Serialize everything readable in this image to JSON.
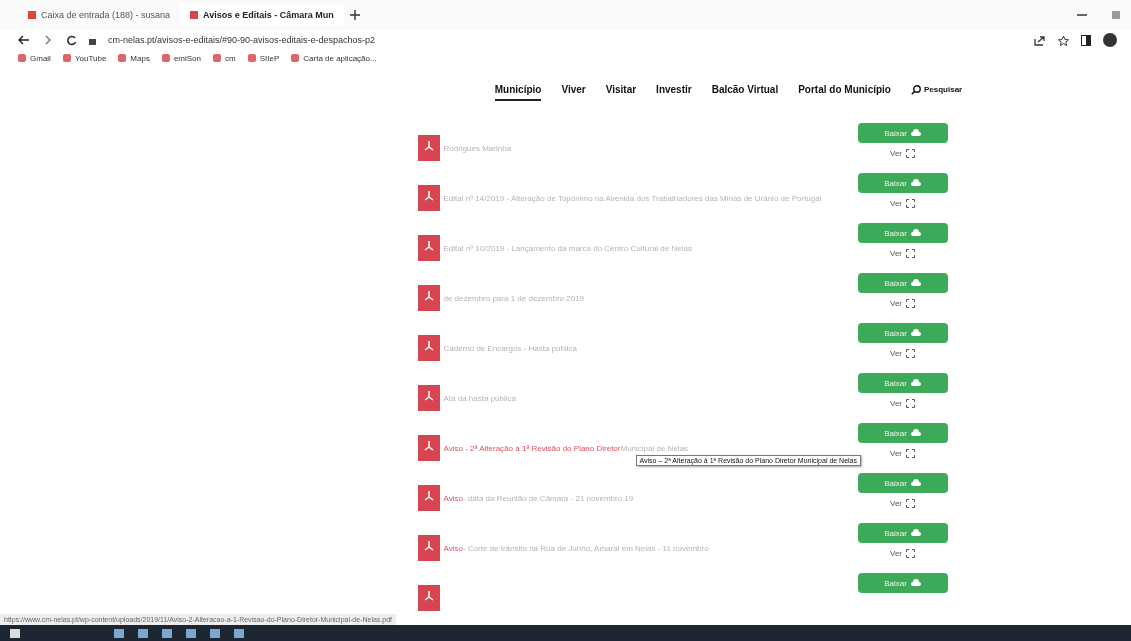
{
  "browser": {
    "tabs": [
      {
        "title": "Caixa de entrada (188) - susana",
        "selected": false
      },
      {
        "title": "Avisos e Editais - Câmara Mun",
        "selected": true
      }
    ],
    "address": "cm-nelas.pt/avisos-e-editais/#90-90-avisos-editais-e-despachos-p2",
    "bookmarks": [
      "Gmail",
      "YouTube",
      "Maps",
      "emiSon",
      "cm",
      "SIIeP",
      "Carta de aplicação..."
    ]
  },
  "nav": [
    {
      "label": "Município",
      "selected": true
    },
    {
      "label": "Viver",
      "selected": false
    },
    {
      "label": "Visitar",
      "selected": false
    },
    {
      "label": "Investir",
      "selected": false
    },
    {
      "label": "Balcão Virtual",
      "selected": false
    },
    {
      "label": "Portal do Município",
      "selected": false
    }
  ],
  "search_label": "Pesquisar",
  "documents": [
    {
      "title": "Rodrigues Marinha",
      "download": "Baixar",
      "view": "Ver"
    },
    {
      "title": "Edital nº 14/2019 - Alteração de Topónimo na Avenida dos Trabalhadores das Minas de Urânio de Portugal",
      "download": "Baixar",
      "view": "Ver"
    },
    {
      "title": "Edital nº 10/2019 - Lançamento da marca do Centro Cultural de Nelas",
      "download": "Baixar",
      "view": "Ver"
    },
    {
      "title": "de dezembro para 1 de dezembro 2019",
      "download": "Baixar",
      "view": "Ver"
    },
    {
      "title": "Caderno de Encargos - Hasta pública",
      "download": "Baixar",
      "view": "Ver"
    },
    {
      "title": "Ata da hasta pública",
      "download": "Baixar",
      "view": "Ver"
    },
    {
      "tag": "Aviso - 2ª Alteração à 1ª Revisão do Plano Diretor",
      "title": "Municipal de Nelas",
      "download": "Baixar",
      "view": "Ver"
    },
    {
      "tag": "Aviso",
      "title": "- data da Reunião de Câmara - 21 novembro 19",
      "download": "Baixar",
      "view": "Ver"
    },
    {
      "tag": "Aviso",
      "title": "- Corte de trânsito na Rua de Junho, Amaral em Nelas - 11 novembro",
      "download": "Baixar",
      "view": "Ver"
    },
    {
      "download": "Baixar"
    }
  ],
  "tooltip": "Aviso – 2ª Alteração à 1ª Revisão do Plano Diretor Municipal de Nelas",
  "status_url": "https://www.cm-nelas.pt/wp-content/uploads/2019/11/Aviso-2-Alteracao-a-1-Revisao-do-Plano-Diretor-Municipal-de-Nelas.pdf"
}
